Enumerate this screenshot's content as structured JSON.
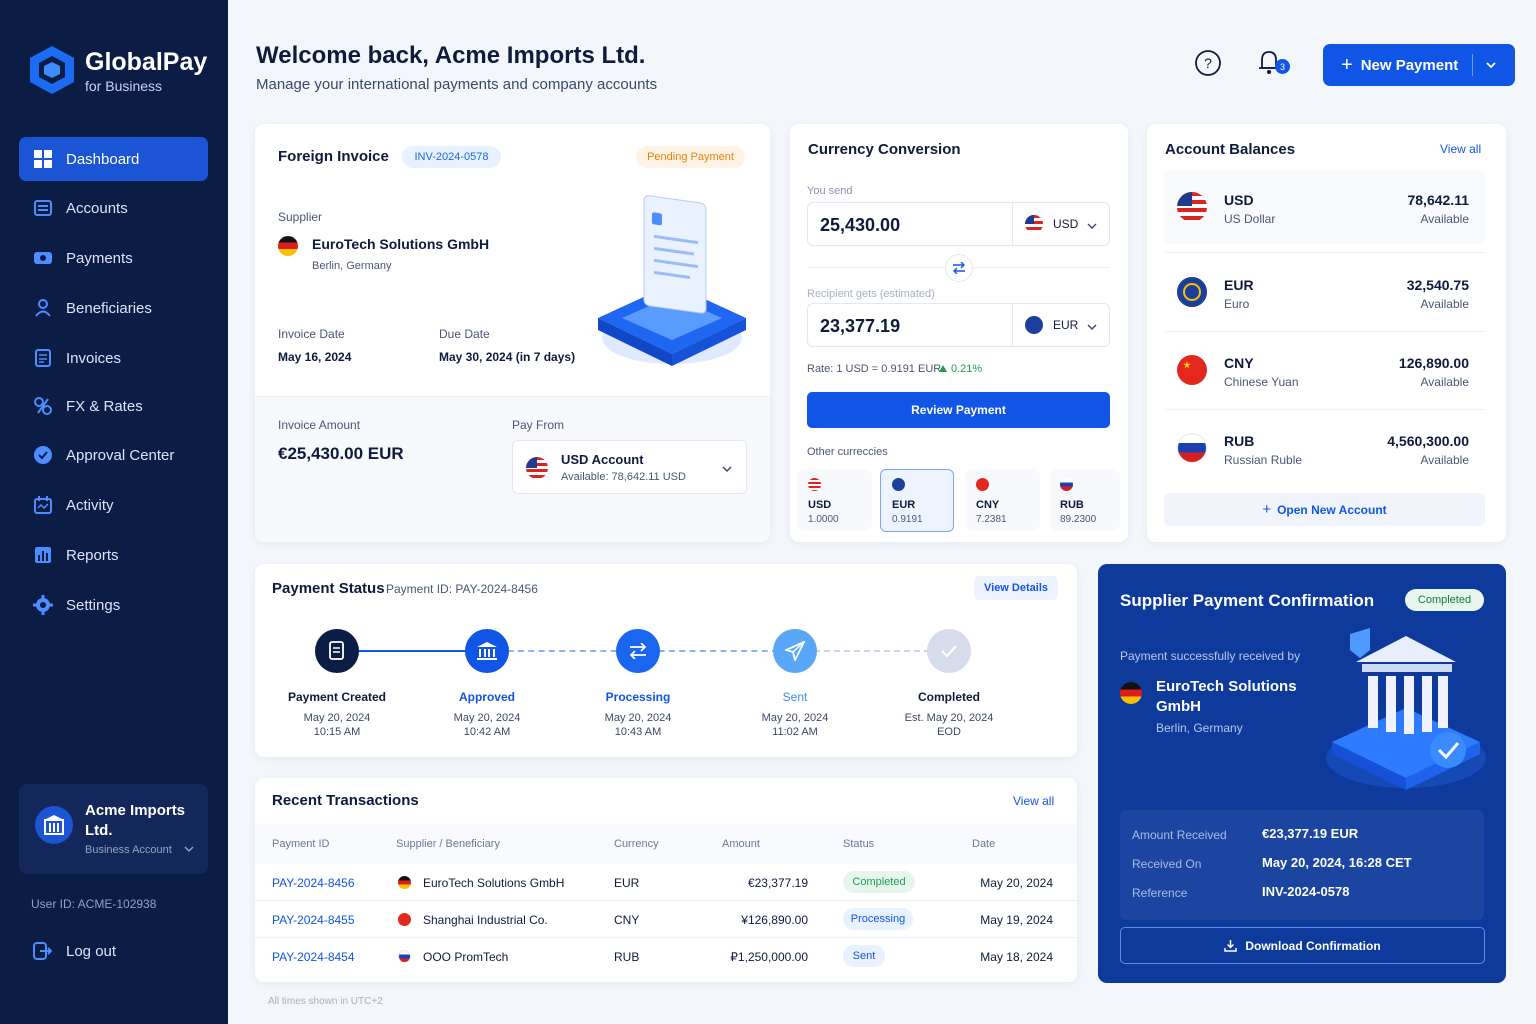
{
  "brand": {
    "name": "GlobalPay",
    "sub": "for Business"
  },
  "nav": [
    {
      "label": "Dashboard",
      "icon": "dashboard-icon"
    },
    {
      "label": "Accounts",
      "icon": "accounts-icon"
    },
    {
      "label": "Payments",
      "icon": "payments-icon"
    },
    {
      "label": "Beneficiaries",
      "icon": "beneficiaries-icon"
    },
    {
      "label": "Invoices",
      "icon": "invoices-icon"
    },
    {
      "label": "FX & Rates",
      "icon": "fx-icon"
    },
    {
      "label": "Approval Center",
      "icon": "approval-icon"
    },
    {
      "label": "Activity",
      "icon": "activity-icon"
    },
    {
      "label": "Reports",
      "icon": "reports-icon"
    },
    {
      "label": "Settings",
      "icon": "settings-icon"
    }
  ],
  "account": {
    "name": "Acme Imports Ltd.",
    "type": "Business Account",
    "user_id": "User ID: ACME-102938"
  },
  "logout": "Log out",
  "header": {
    "title": "Welcome back, Acme Imports Ltd.",
    "subtitle": "Manage your international payments and company accounts",
    "notif_count": "3",
    "new_payment": "New Payment"
  },
  "invoice": {
    "title": "Foreign Invoice",
    "id": "INV-2024-0578",
    "status": "Pending Payment",
    "supplier_label": "Supplier",
    "supplier": "EuroTech Solutions GmbH",
    "location": "Berlin, Germany",
    "invoice_date_label": "Invoice Date",
    "invoice_date": "May 16, 2024",
    "due_date_label": "Due Date",
    "due_date": "May 30, 2024 (in 7 days)",
    "amount_label": "Invoice Amount",
    "amount": "€25,430.00 EUR",
    "pay_from_label": "Pay From",
    "pay_from": "USD Account",
    "pay_from_avail": "Available: 78,642.11 USD"
  },
  "conversion": {
    "title": "Currency Conversion",
    "send_label": "You send",
    "send_amount": "25,430.00",
    "send_cur": "USD",
    "recv_label": "Recipient gets (estimated)",
    "recv_amount": "23,377.19",
    "recv_cur": "EUR",
    "rate": "Rate: 1 USD = 0.9191 EUR",
    "change": "0.21%",
    "review": "Review Payment",
    "other_label": "Other curreccies",
    "others": [
      {
        "code": "USD",
        "rate": "1.0000"
      },
      {
        "code": "EUR",
        "rate": "0.9191"
      },
      {
        "code": "CNY",
        "rate": "7.2381"
      },
      {
        "code": "RUB",
        "rate": "89.2300"
      }
    ]
  },
  "balances": {
    "title": "Account Balances",
    "view_all": "View all",
    "rows": [
      {
        "code": "USD",
        "name": "US Dollar",
        "amount": "78,642.11",
        "status": "Available"
      },
      {
        "code": "EUR",
        "name": "Euro",
        "amount": "32,540.75",
        "status": "Available"
      },
      {
        "code": "CNY",
        "name": "Chinese Yuan",
        "amount": "126,890.00",
        "status": "Available"
      },
      {
        "code": "RUB",
        "name": "Russian Ruble",
        "amount": "4,560,300.00",
        "status": "Available"
      }
    ],
    "open_new": "Open New Account"
  },
  "payment_status": {
    "title": "Payment Status",
    "id": "Payment ID: PAY-2024-8456",
    "view_details": "View Details",
    "steps": [
      {
        "label": "Payment Created",
        "date": "May 20, 2024",
        "time": "10:15 AM"
      },
      {
        "label": "Approved",
        "date": "May 20, 2024",
        "time": "10:42 AM"
      },
      {
        "label": "Processing",
        "date": "May 20, 2024",
        "time": "10:43 AM"
      },
      {
        "label": "Sent",
        "date": "May 20, 2024",
        "time": "11:02 AM"
      },
      {
        "label": "Completed",
        "date": "Est. May 20, 2024",
        "time": "EOD"
      }
    ]
  },
  "transactions": {
    "title": "Recent Transactions",
    "view_all": "View all",
    "headers": [
      "Payment ID",
      "Supplier / Beneficiary",
      "Currency",
      "Amount",
      "Status",
      "Date"
    ],
    "rows": [
      {
        "id": "PAY-2024-8456",
        "supplier": "EuroTech Solutions GmbH",
        "currency": "EUR",
        "amount": "€23,377.19",
        "status": "Completed",
        "date": "May 20, 2024"
      },
      {
        "id": "PAY-2024-8455",
        "supplier": "Shanghai Industrial Co.",
        "currency": "CNY",
        "amount": "¥126,890.00",
        "status": "Processing",
        "date": "May 19, 2024"
      },
      {
        "id": "PAY-2024-8454",
        "supplier": "OOO PromTech",
        "currency": "RUB",
        "amount": "₽1,250,000.00",
        "status": "Sent",
        "date": "May 18, 2024"
      }
    ],
    "footnote": "All times shown in UTC+2"
  },
  "confirmation": {
    "title": "Supplier Payment Confirmation",
    "status": "Completed",
    "received_by": "Payment successfully received by",
    "supplier": "EuroTech Solutions GmbH",
    "location": "Berlin, Germany",
    "details": [
      {
        "label": "Amount Received",
        "value": "€23,377.19 EUR"
      },
      {
        "label": "Received On",
        "value": "May 20, 2024, 16:28 CET"
      },
      {
        "label": "Reference",
        "value": "INV-2024-0578"
      }
    ],
    "download": "Download Confirmation"
  },
  "colors": {
    "primary": "#1155e6",
    "sidebar": "#0b1c45",
    "success": "#1f9d57",
    "pending": "#e8830c",
    "confirm_bg": "#0e3a9c"
  }
}
